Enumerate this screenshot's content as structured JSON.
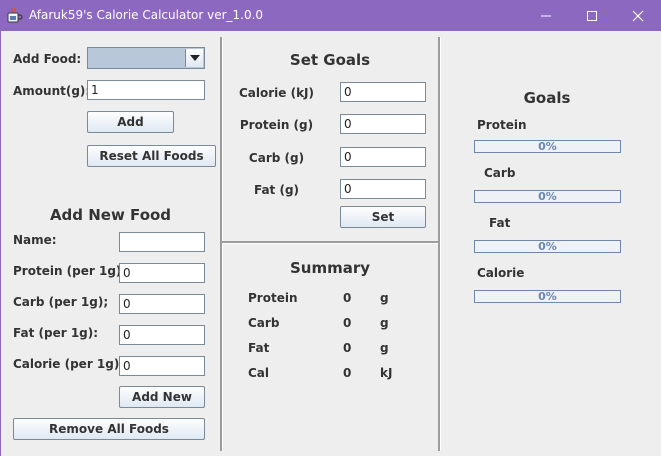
{
  "window": {
    "title": "Afaruk59's Calorie Calculator ver_1.0.0"
  },
  "add_food": {
    "food_label": "Add Food:",
    "selected_food": "",
    "amount_label": "Amount(g):",
    "amount_value": "1",
    "add_button": "Add",
    "reset_button": "Reset All Foods"
  },
  "new_food": {
    "heading": "Add New Food",
    "name_label": "Name:",
    "name_value": "",
    "protein_label": "Protein (per 1g):",
    "protein_value": "0",
    "carb_label": "Carb (per 1g);",
    "carb_value": "0",
    "fat_label": "Fat (per 1g):",
    "fat_value": "0",
    "calorie_label": "Calorie (per 1g);",
    "calorie_value": "0",
    "add_new_button": "Add New",
    "remove_all_button": "Remove All Foods"
  },
  "set_goals": {
    "heading": "Set Goals",
    "calorie_label": "Calorie (kJ)",
    "calorie_value": "0",
    "protein_label": "Protein (g)",
    "protein_value": "0",
    "carb_label": "Carb (g)",
    "carb_value": "0",
    "fat_label": "Fat (g)",
    "fat_value": "0",
    "set_button": "Set"
  },
  "summary": {
    "heading": "Summary",
    "rows": [
      {
        "name": "Protein",
        "value": "0",
        "unit": "g"
      },
      {
        "name": "Carb",
        "value": "0",
        "unit": "g"
      },
      {
        "name": "Fat",
        "value": "0",
        "unit": "g"
      },
      {
        "name": "Cal",
        "value": "0",
        "unit": "kJ"
      }
    ]
  },
  "goals": {
    "heading": "Goals",
    "bars": [
      {
        "label": "Protein",
        "text": "0%",
        "percent": 0
      },
      {
        "label": "Carb",
        "text": "0%",
        "percent": 0
      },
      {
        "label": "Fat",
        "text": "0%",
        "percent": 0
      },
      {
        "label": "Calorie",
        "text": "0%",
        "percent": 0
      }
    ]
  },
  "colors": {
    "titlebar": "#8d68c0",
    "progress_text": "#6a86b3"
  },
  "icons": {
    "app": "java-cup-icon",
    "minimize": "minimize-icon",
    "maximize": "maximize-icon",
    "close": "close-icon",
    "dropdown": "chevron-down-icon"
  }
}
